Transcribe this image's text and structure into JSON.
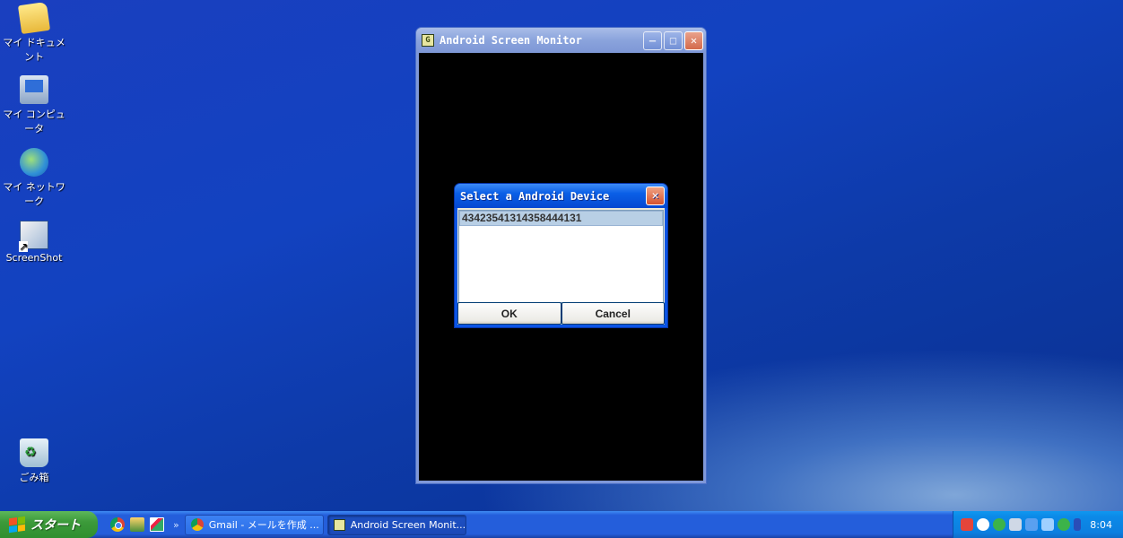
{
  "desktop": {
    "icons": [
      {
        "label": "マイ ドキュメント",
        "icon": "my-documents-icon"
      },
      {
        "label": "マイ コンピュータ",
        "icon": "my-computer-icon"
      },
      {
        "label": "マイ ネットワーク",
        "icon": "my-network-icon"
      },
      {
        "label": "ScreenShot",
        "icon": "screenshot-shortcut-icon"
      },
      {
        "label": "ごみ箱",
        "icon": "recycle-bin-icon"
      }
    ]
  },
  "app_window": {
    "title": "Android Screen Monitor",
    "icon_glyph": "G",
    "minimize_glyph": "–",
    "maximize_glyph": "□",
    "close_glyph": "✕"
  },
  "dialog": {
    "title": "Select a Android Device",
    "close_glyph": "✕",
    "devices": [
      "43423541314358444131"
    ],
    "ok_label": "OK",
    "cancel_label": "Cancel"
  },
  "taskbar": {
    "start_label": "スタート",
    "chevron": "»",
    "tasks": [
      {
        "label": "Gmail - メールを作成 ...",
        "icon": "chrome-icon",
        "active": false
      },
      {
        "label": "Android Screen Monit...",
        "icon": "asm-icon",
        "active": true
      }
    ],
    "clock": "8:04"
  },
  "colors": {
    "titlebar_blue": "#0a5fe6",
    "start_green": "#3c9a3a",
    "close_red": "#d5532e"
  }
}
